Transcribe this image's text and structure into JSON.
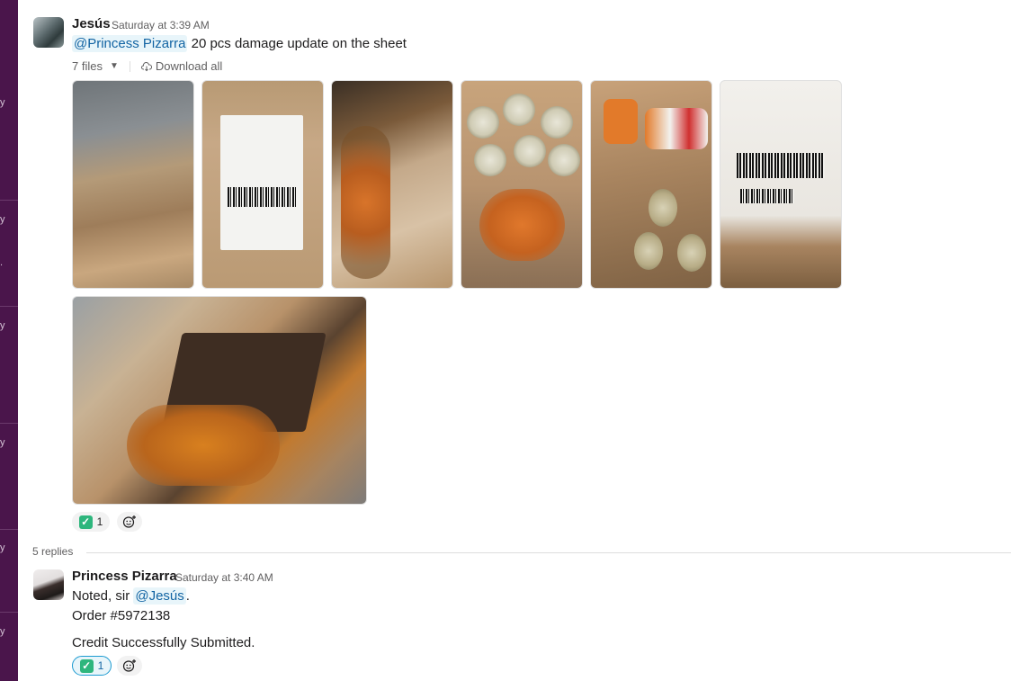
{
  "sidebar": {
    "fragments": [
      {
        "text": "y"
      },
      {
        "text": "y"
      },
      {
        "text": "."
      },
      {
        "text": "y"
      },
      {
        "text": "y"
      },
      {
        "text": "y"
      },
      {
        "text": "y"
      }
    ]
  },
  "post": {
    "author": "Jesús",
    "time": "Saturday at 3:39 AM",
    "mention": "@Princess Pizarra",
    "text": " 20 pcs damage update on the sheet",
    "files_label": "7 files",
    "download_label": "Download all",
    "reaction": {
      "emoji": "✅",
      "count": "1"
    }
  },
  "replies_label": "5 replies",
  "reply": {
    "author": "Princess Pizarra",
    "time": "Saturday at 3:40 AM",
    "line1_prefix": "Noted, sir ",
    "line1_mention": "@Jesús",
    "line1_suffix": ".",
    "line2": "Order #5972138",
    "line3": "Credit Successfully Submitted.",
    "reaction": {
      "emoji": "✅",
      "count": "1"
    }
  },
  "colors": {
    "sidebar": "#4a154b",
    "mention_bg": "#e8f5fa",
    "mention_text": "#1264a3",
    "check": "#2eb67d"
  }
}
